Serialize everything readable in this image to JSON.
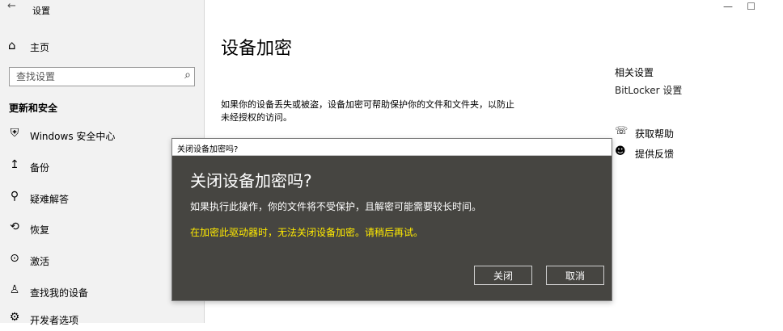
{
  "app": {
    "title": "设置",
    "back_icon": "←"
  },
  "window_controls": {
    "minimize": "—",
    "maximize": "☐"
  },
  "sidebar": {
    "home": {
      "icon": "⌂",
      "label": "主页"
    },
    "search": {
      "placeholder": "查找设置",
      "icon": "⌕"
    },
    "section": "更新和安全",
    "items": [
      {
        "icon": "⛨",
        "label": "Windows 安全中心"
      },
      {
        "icon": "↥",
        "label": "备份"
      },
      {
        "icon": "⚲",
        "label": "疑难解答"
      },
      {
        "icon": "⟲",
        "label": "恢复"
      },
      {
        "icon": "⊙",
        "label": "激活"
      },
      {
        "icon": "♙",
        "label": "查找我的设备"
      },
      {
        "icon": "⚙",
        "label": "开发者选项"
      }
    ]
  },
  "main": {
    "title": "设备加密",
    "description": "如果你的设备丢失或被盗，设备加密可帮助保护你的文件和文件夹，以防止未经授权的访问。"
  },
  "related": {
    "title": "相关设置",
    "bitlocker": "BitLocker 设置",
    "help": {
      "icon": "☏",
      "label": "获取帮助"
    },
    "feedback": {
      "icon": "☻",
      "label": "提供反馈"
    }
  },
  "dialog": {
    "title": "关闭设备加密吗?",
    "heading": "关闭设备加密吗?",
    "message": "如果执行此操作，你的文件将不受保护，且解密可能需要较长时间。",
    "warning": "在加密此驱动器时，无法关闭设备加密。请稍后再试。",
    "close_button": "关闭",
    "cancel_button": "取消"
  },
  "colors": {
    "dialog_bg": "#464541",
    "warning_text": "#ffea00",
    "sidebar_bg": "#f2f2f2"
  }
}
